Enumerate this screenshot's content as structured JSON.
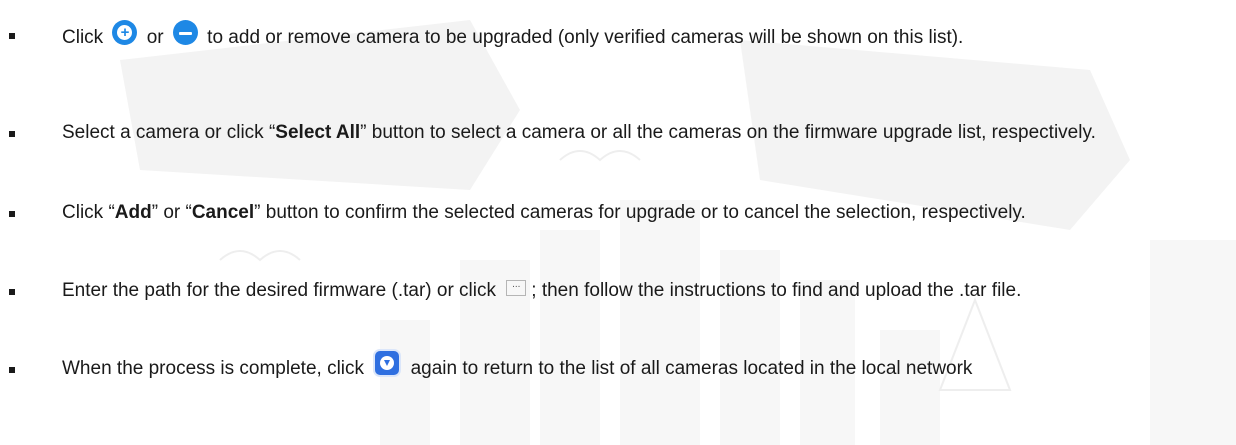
{
  "bullets": [
    {
      "pre": "Click ",
      "icon_a": "plus-circle-icon",
      "mid1": " or ",
      "icon_b": "minus-circle-icon",
      "post": " to add or remove camera to be upgraded (only verified cameras will be shown on this list)."
    },
    {
      "pre": "Select a camera or click “",
      "bold": "Select All",
      "post": "” button to select a camera or all the cameras on the firmware upgrade list, respectively."
    },
    {
      "pre": "Click “",
      "bold1": "Add",
      "mid": "” or “",
      "bold2": "Cancel",
      "post": "” button to confirm the selected cameras for upgrade or to cancel the selection, respectively."
    },
    {
      "pre": "Enter the path for the desired firmware (.tar) or click ",
      "icon": "browse-icon",
      "icon_text": "...",
      "post": "; then follow the instructions to find and upload the .tar file."
    },
    {
      "pre": "When the process is complete, click ",
      "icon": "firmware-upgrade-icon",
      "post": " again to return to the list of all cameras located in the local network"
    }
  ],
  "colors": {
    "text": "#1a1a1a",
    "icon_blue": "#1e88e5",
    "upgrade_icon_blue": "#2f6fe0"
  }
}
